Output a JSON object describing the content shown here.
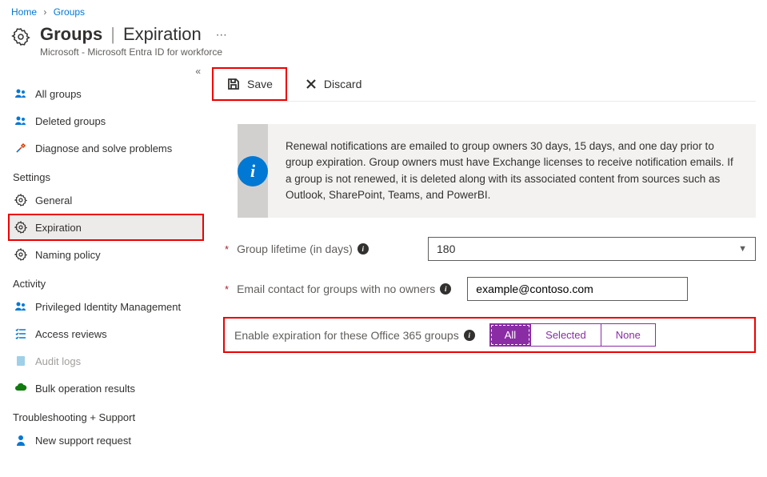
{
  "breadcrumb": {
    "home": "Home",
    "groups": "Groups"
  },
  "header": {
    "title_bold": "Groups",
    "title_rest": "Expiration",
    "subtitle": "Microsoft - Microsoft Entra ID for workforce"
  },
  "toolbar": {
    "save": "Save",
    "discard": "Discard"
  },
  "sidebar": {
    "items": {
      "all_groups": "All groups",
      "deleted_groups": "Deleted groups",
      "diagnose": "Diagnose and solve problems"
    },
    "settings_label": "Settings",
    "settings": {
      "general": "General",
      "expiration": "Expiration",
      "naming_policy": "Naming policy"
    },
    "activity_label": "Activity",
    "activity": {
      "pim": "Privileged Identity Management",
      "access_reviews": "Access reviews",
      "audit_logs": "Audit logs",
      "bulk_ops": "Bulk operation results"
    },
    "support_label": "Troubleshooting + Support",
    "support": {
      "new_request": "New support request"
    }
  },
  "info": {
    "text": "Renewal notifications are emailed to group owners 30 days, 15 days, and one day prior to group expiration. Group owners must have Exchange licenses to receive notification emails. If a group is not renewed, it is deleted along with its associated content from sources such as Outlook, SharePoint, Teams, and PowerBI."
  },
  "form": {
    "lifetime_label": "Group lifetime (in days)",
    "lifetime_value": "180",
    "email_label": "Email contact for groups with no owners",
    "email_value": "example@contoso.com",
    "enable_label": "Enable expiration for these Office 365 groups",
    "seg": {
      "all": "All",
      "selected": "Selected",
      "none": "None"
    }
  }
}
